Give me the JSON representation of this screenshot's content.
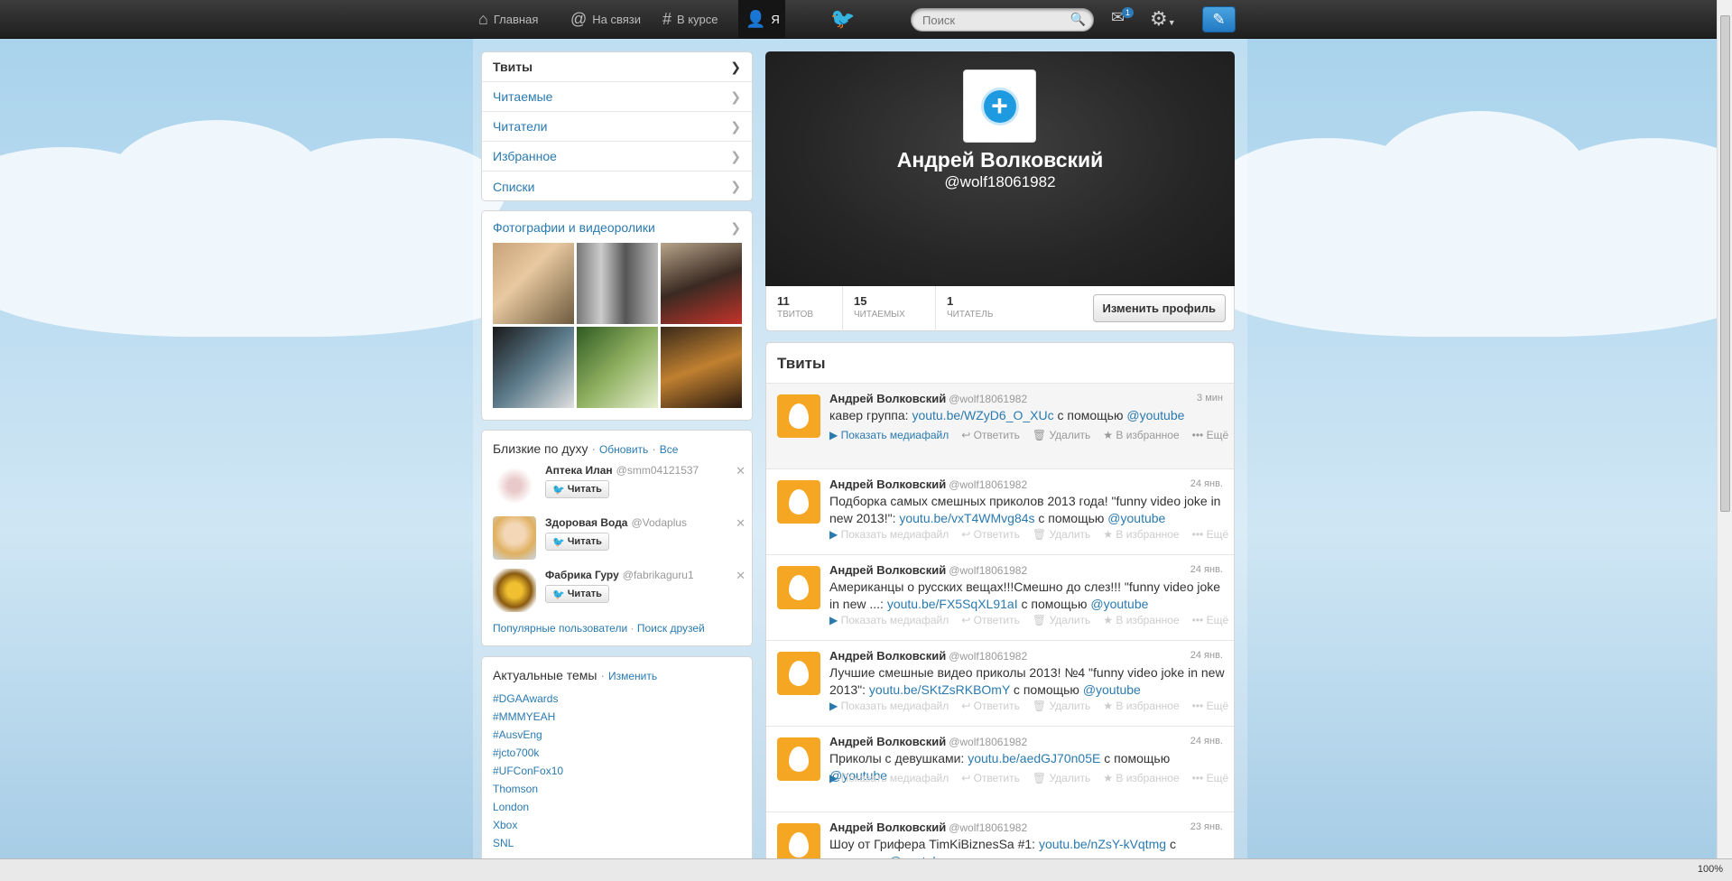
{
  "nav": {
    "home": "Главная",
    "connect": "На связи",
    "discover": "В курсе",
    "me": "Я",
    "search_placeholder": "Поиск",
    "dm_count": "1"
  },
  "sidebar": {
    "menu": [
      {
        "label": "Твиты"
      },
      {
        "label": "Читаемые"
      },
      {
        "label": "Читатели"
      },
      {
        "label": "Избранное"
      },
      {
        "label": "Списки"
      }
    ],
    "media_title": "Фотографии и видеоролики",
    "wtf_title": "Близкие по духу",
    "wtf_refresh": "Обновить",
    "wtf_all": "Все",
    "follow_label": "Читать",
    "suggestions": [
      {
        "name": "Аптека Илан",
        "handle": "@smm04121537"
      },
      {
        "name": "Здоровая Вода",
        "handle": "@Vodaplus"
      },
      {
        "name": "Фабрика Гуру",
        "handle": "@fabrikaguru1"
      }
    ],
    "popular_users": "Популярные пользователи",
    "find_friends": "Поиск друзей",
    "trends_title": "Актуальные темы",
    "trends_change": "Изменить",
    "trends": [
      "#DGAAwards",
      "#MMMYEAH",
      "#AusvEng",
      "#jcto700k",
      "#UFConFox10",
      "Thomson",
      "London",
      "Xbox",
      "SNL"
    ]
  },
  "profile": {
    "name": "Андрей Волковский",
    "handle": "@wolf18061982",
    "tweets_count": "11",
    "tweets_label": "твитов",
    "following_count": "15",
    "following_label": "читаемых",
    "followers_count": "1",
    "followers_label": "читатель",
    "edit_label": "Изменить профиль"
  },
  "tweets_title": "Твиты",
  "tweet_actions": {
    "media": "Показать медиафайл",
    "reply": "Ответить",
    "delete": "Удалить",
    "favorite": "В избранное",
    "more": "Ещё"
  },
  "tweets": [
    {
      "name": "Андрей Волковский",
      "handle": "@wolf18061982",
      "time": "3 мин",
      "text_before": "кавер группа: ",
      "link": "youtu.be/WZyD6_O_XUc",
      "text_after": " с помощью ",
      "mention": "@youtube"
    },
    {
      "name": "Андрей Волковский",
      "handle": "@wolf18061982",
      "time": "24 янв.",
      "text_before": "Подборка самых смешных приколов 2013 года! \"funny video joke in new 2013!\": ",
      "link": "youtu.be/vxT4WMvg84s",
      "text_after": " с помощью ",
      "mention": "@youtube"
    },
    {
      "name": "Андрей Волковский",
      "handle": "@wolf18061982",
      "time": "24 янв.",
      "text_before": "Американцы о русских вещах!!!Смешно до слез!!! \"funny video joke in new ...: ",
      "link": "youtu.be/FX5SqXL91aI",
      "text_after": " с помощью ",
      "mention": "@youtube"
    },
    {
      "name": "Андрей Волковский",
      "handle": "@wolf18061982",
      "time": "24 янв.",
      "text_before": "Лучшие смешные видео приколы 2013! №4 \"funny video joke in new 2013\": ",
      "link": "youtu.be/SKtZsRKBOmY",
      "text_after": " с помощью ",
      "mention": "@youtube"
    },
    {
      "name": "Андрей Волковский",
      "handle": "@wolf18061982",
      "time": "24 янв.",
      "text_before": "Приколы с девушками: ",
      "link": "youtu.be/aedGJ70n05E",
      "text_after": " с помощью ",
      "mention": "@youtube"
    },
    {
      "name": "Андрей Волковский",
      "handle": "@wolf18061982",
      "time": "23 янв.",
      "text_before": "Шоу от Грифера TimKiBiznesSa #1: ",
      "link": "youtu.be/nZsY-kVqtmg",
      "text_after": " с помощью ",
      "mention": "@youtube"
    }
  ],
  "statusbar": {
    "zoom": "100%"
  },
  "colors": {
    "accent": "#2a7ab0",
    "egg": "#f5a623",
    "topbar": "#2b2b2b"
  }
}
